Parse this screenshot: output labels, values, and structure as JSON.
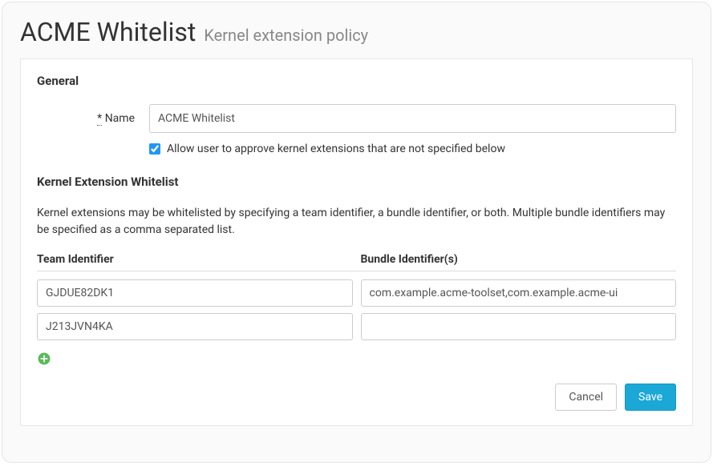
{
  "header": {
    "title": "ACME Whitelist",
    "subtitle": "Kernel extension policy"
  },
  "sections": {
    "general": {
      "heading": "General",
      "name_label": "Name",
      "required_marker": "*",
      "name_value": "ACME Whitelist",
      "allow_user_checked": true,
      "allow_user_label": "Allow user to approve kernel extensions that are not specified below"
    },
    "whitelist": {
      "heading": "Kernel Extension Whitelist",
      "description": "Kernel extensions may be whitelisted by specifying a team identifier, a bundle identifier, or both. Multiple bundle identifiers may be specified as a comma separated list.",
      "columns": {
        "team": "Team Identifier",
        "bundle": "Bundle Identifier(s)"
      },
      "rows": [
        {
          "team": "GJDUE82DK1",
          "bundle": "com.example.acme-toolset,com.example.acme-ui"
        },
        {
          "team": "J213JVN4KA",
          "bundle": ""
        }
      ]
    }
  },
  "footer": {
    "cancel": "Cancel",
    "save": "Save"
  },
  "colors": {
    "accent": "#1ba8d6",
    "add_icon": "#5cb85c"
  }
}
